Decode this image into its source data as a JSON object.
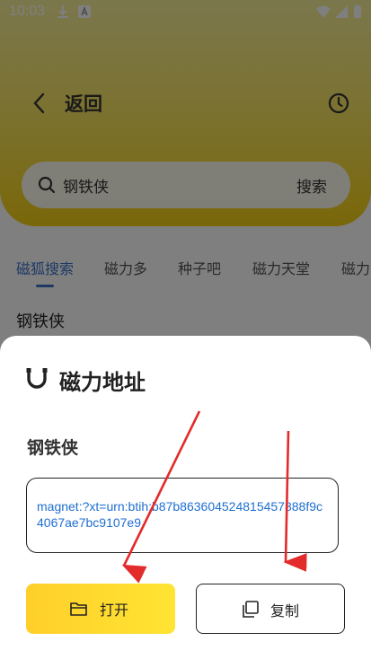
{
  "status_bar": {
    "time": "10:03"
  },
  "header": {
    "back_label": "返回"
  },
  "search": {
    "query": "钢铁侠",
    "button_label": "搜索"
  },
  "tabs": [
    {
      "label": "磁狐搜索",
      "active": true
    },
    {
      "label": "磁力多",
      "active": false
    },
    {
      "label": "种子吧",
      "active": false
    },
    {
      "label": "磁力天堂",
      "active": false
    },
    {
      "label": "磁力",
      "active": false
    }
  ],
  "result": {
    "title": "钢铁侠"
  },
  "sheet": {
    "title": "磁力地址",
    "item_name": "钢铁侠",
    "magnet": "magnet:?xt=urn:btih:b87b8636045248​15457888f9c4067ae7bc9107e9",
    "open_label": "打开",
    "copy_label": "复制"
  },
  "colors": {
    "accent_yellow": "#ffd42a",
    "link_blue": "#1f6fd1",
    "tab_active": "#3a73c9",
    "arrow_red": "#e32b2b"
  }
}
